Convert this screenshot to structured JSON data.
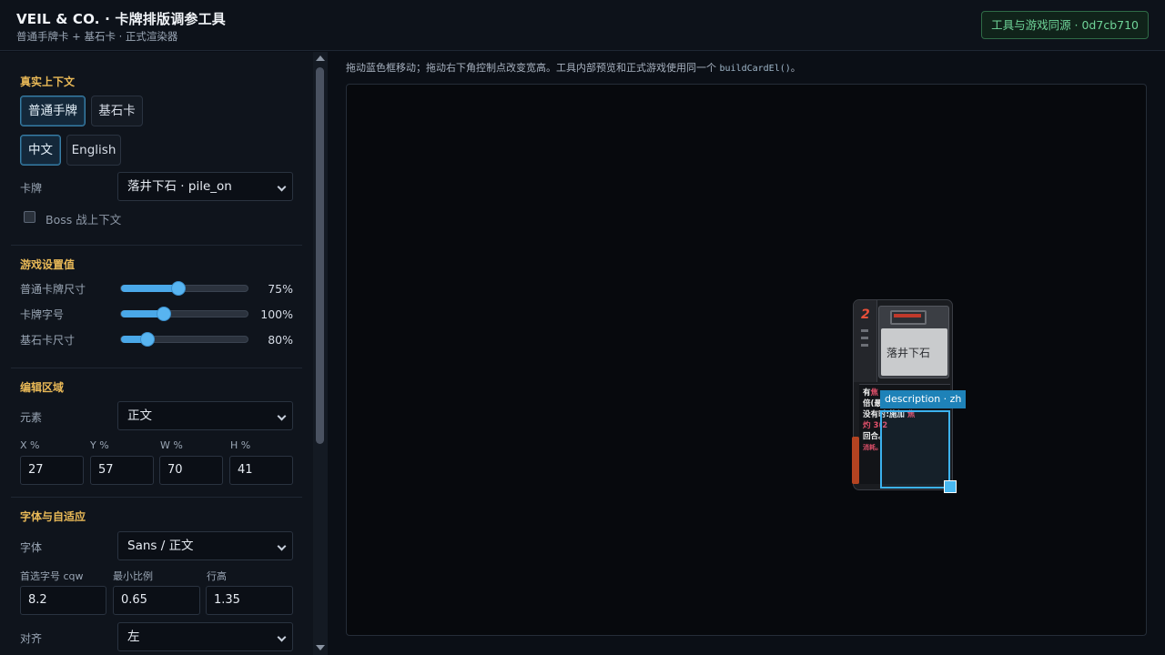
{
  "header": {
    "title": "VEIL & CO. · 卡牌排版调参工具",
    "subtitle": "普通手牌卡 + 基石卡 · 正式渲染器",
    "sync_badge": "工具与游戏同源 · 0d7cb710"
  },
  "context": {
    "title": "真实上下文",
    "card_type_tabs": [
      {
        "label": "普通手牌",
        "active": true
      },
      {
        "label": "基石卡",
        "active": false
      }
    ],
    "language_tabs": [
      {
        "label": "中文",
        "active": true
      },
      {
        "label": "English",
        "active": false
      }
    ],
    "card_label": "卡牌",
    "card_value": "落井下石 · pile_on",
    "boss_checkbox_label": "Boss 战上下文",
    "boss_checked": false
  },
  "settings": {
    "title": "游戏设置值",
    "sliders": [
      {
        "label": "普通卡牌尺寸",
        "value": 0.75,
        "display": "75%"
      },
      {
        "label": "卡牌字号",
        "value": 0.5,
        "display": "100%"
      },
      {
        "label": "基石卡尺寸",
        "value": 0.2,
        "display": "80%"
      }
    ]
  },
  "edit": {
    "title": "编辑区域",
    "element_label": "元素",
    "element_value": "正文",
    "fields": [
      {
        "label": "X %",
        "value": "27"
      },
      {
        "label": "Y %",
        "value": "57"
      },
      {
        "label": "W %",
        "value": "70"
      },
      {
        "label": "H %",
        "value": "41"
      }
    ]
  },
  "font": {
    "title": "字体与自适应",
    "font_label": "字体",
    "font_value": "Sans / 正文",
    "fields": [
      {
        "label": "首选字号 cqw",
        "value": "8.2"
      },
      {
        "label": "最小比例",
        "value": "0.65"
      },
      {
        "label": "行高",
        "value": "1.35"
      }
    ],
    "align_label": "对齐",
    "align_value": "左"
  },
  "canvas": {
    "hint": "拖动蓝色框移动；拖动右下角控制点改变宽高。工具内部预览和正式游戏使用同一个 ",
    "hint_code": "buildCardEl()",
    "hint_end": "。",
    "card": {
      "cost": "2",
      "name": "落井下石",
      "desc_lines": [
        {
          "text": "有",
          "hl": "焦"
        },
        {
          "text": "倍(最",
          "hl": ""
        },
        {
          "text": "没有时:施加 ",
          "hl": "焦灼 3(2"
        },
        {
          "text": "回合。",
          "hl": ""
        }
      ],
      "exhaust_tag": "消耗。"
    },
    "selection_tag": "description · zh"
  },
  "colors": {
    "accent": "#4aa8e8",
    "section_title": "#e9b957",
    "badge_green": "#6fd498",
    "selection": "#3cb2ef"
  }
}
